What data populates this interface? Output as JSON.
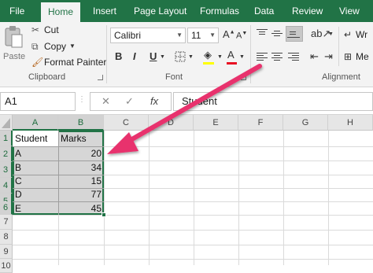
{
  "tabs": [
    "File",
    "Home",
    "Insert",
    "Page Layout",
    "Formulas",
    "Data",
    "Review",
    "View"
  ],
  "active_tab": "Home",
  "clipboard": {
    "paste_label": "Paste",
    "cut_label": "Cut",
    "copy_label": "Copy",
    "format_painter_label": "Format Painter",
    "group_label": "Clipboard"
  },
  "font": {
    "font_name": "Calibri",
    "font_size": "11",
    "bold": "B",
    "italic": "I",
    "underline": "U",
    "color_letter": "A",
    "group_label": "Font",
    "highlight_color": "#ffff00",
    "font_color": "#e81123"
  },
  "alignment": {
    "wrap_label": "Wr",
    "merge_label": "Me",
    "group_label": "Alignment"
  },
  "formula_bar": {
    "name_box": "A1",
    "fx": "fx",
    "content": "Student"
  },
  "columns": [
    "A",
    "B",
    "C",
    "D",
    "E",
    "F",
    "G",
    "H"
  ],
  "rows": [
    "1",
    "2",
    "3",
    "4",
    "5",
    "6",
    "7",
    "8",
    "9",
    "10"
  ],
  "sheet": {
    "header": [
      "Student",
      "Marks"
    ],
    "data": [
      [
        "A",
        "20"
      ],
      [
        "B",
        "34"
      ],
      [
        "C",
        "15"
      ],
      [
        "D",
        "77"
      ],
      [
        "E",
        "45"
      ]
    ]
  },
  "colors": {
    "accent": "#217346",
    "arrow": "#e8336d"
  }
}
